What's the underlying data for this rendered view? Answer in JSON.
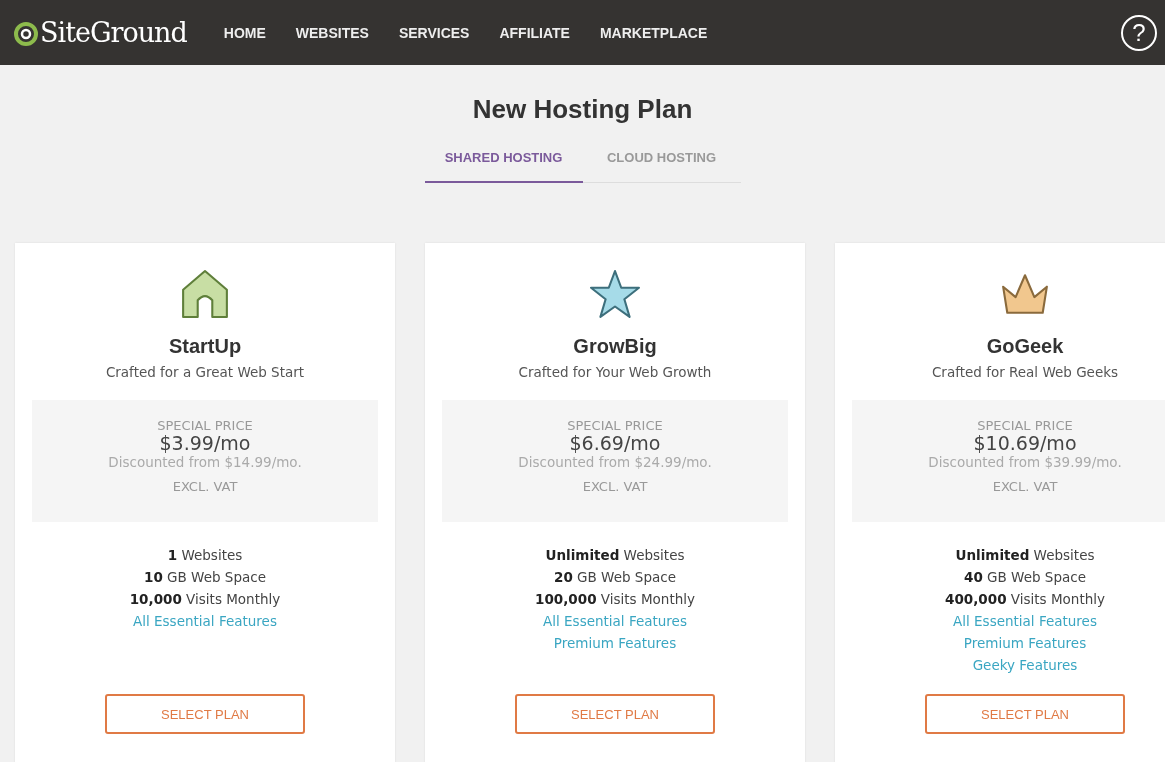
{
  "header": {
    "logo": "SiteGround",
    "nav": [
      {
        "label": "HOME"
      },
      {
        "label": "WEBSITES"
      },
      {
        "label": "SERVICES"
      },
      {
        "label": "AFFILIATE"
      },
      {
        "label": "MARKETPLACE"
      }
    ],
    "help": "?"
  },
  "title": "New Hosting Plan",
  "tabs": [
    {
      "label": "SHARED HOSTING",
      "selected": true
    },
    {
      "label": "CLOUD HOSTING",
      "selected": false
    }
  ],
  "plans": [
    {
      "kind": "house",
      "name": "StartUp",
      "subtitle": "Crafted for a Great Web Start",
      "price_label": "SPECIAL PRICE",
      "price": "$3.99/mo",
      "discount": "Discounted from $14.99/mo.",
      "vat": "EXCL. VAT",
      "features": [
        {
          "kind": "stat",
          "text": "**1** Websites"
        },
        {
          "kind": "stat",
          "text": "**10** GB Web Space"
        },
        {
          "kind": "stat",
          "text": "**10,000** Visits Monthly"
        },
        {
          "kind": "link",
          "text": "All Essential Features"
        }
      ],
      "button": "SELECT PLAN"
    },
    {
      "kind": "star",
      "name": "GrowBig",
      "subtitle": "Crafted for Your Web Growth",
      "price_label": "SPECIAL PRICE",
      "price": "$6.69/mo",
      "discount": "Discounted from $24.99/mo.",
      "vat": "EXCL. VAT",
      "features": [
        {
          "kind": "stat",
          "text": "**Unlimited** Websites"
        },
        {
          "kind": "stat",
          "text": "**20** GB Web Space"
        },
        {
          "kind": "stat",
          "text": "**100,000** Visits Monthly"
        },
        {
          "kind": "link",
          "text": "All Essential Features"
        },
        {
          "kind": "link",
          "text": "Premium Features"
        }
      ],
      "button": "SELECT PLAN"
    },
    {
      "kind": "crown",
      "name": "GoGeek",
      "subtitle": "Crafted for Real Web Geeks",
      "price_label": "SPECIAL PRICE",
      "price": "$10.69/mo",
      "discount": "Discounted from $39.99/mo.",
      "vat": "EXCL. VAT",
      "features": [
        {
          "kind": "stat",
          "text": "**Unlimited** Websites"
        },
        {
          "kind": "stat",
          "text": "**40** GB Web Space"
        },
        {
          "kind": "stat",
          "text": "**400,000** Visits Monthly"
        },
        {
          "kind": "link",
          "text": "All Essential Features"
        },
        {
          "kind": "link",
          "text": "Premium Features"
        },
        {
          "kind": "link",
          "text": "Geeky Features"
        }
      ],
      "button": "SELECT PLAN"
    }
  ]
}
